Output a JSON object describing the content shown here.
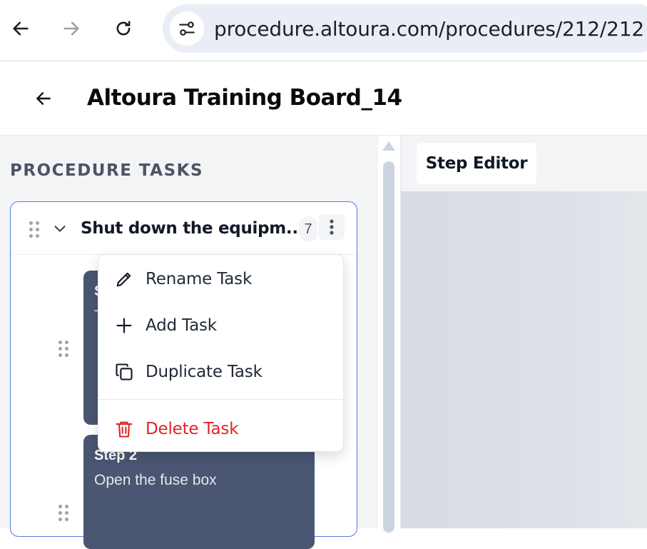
{
  "browser": {
    "url": "procedure.altoura.com/procedures/212/212"
  },
  "header": {
    "title": "Altoura Training Board_14"
  },
  "left_panel": {
    "heading": "PROCEDURE TASKS",
    "task": {
      "title": "Shut down the equipm...",
      "step_count": "7"
    },
    "steps": [
      {
        "title": "S",
        "description": "T"
      },
      {
        "title": "Step 2",
        "description": "Open the fuse box"
      }
    ]
  },
  "right_area": {
    "tab_label": "Step Editor"
  },
  "context_menu": {
    "items": [
      {
        "label": "Rename Task",
        "icon": "pencil-icon"
      },
      {
        "label": "Add Task",
        "icon": "plus-icon"
      },
      {
        "label": "Duplicate Task",
        "icon": "copy-icon"
      },
      {
        "label": "Delete Task",
        "icon": "trash-icon",
        "color": "#dc2626"
      }
    ]
  },
  "colors": {
    "accent_border": "#4f7fd8",
    "step_card": "#4a5672",
    "danger": "#dc2626"
  }
}
